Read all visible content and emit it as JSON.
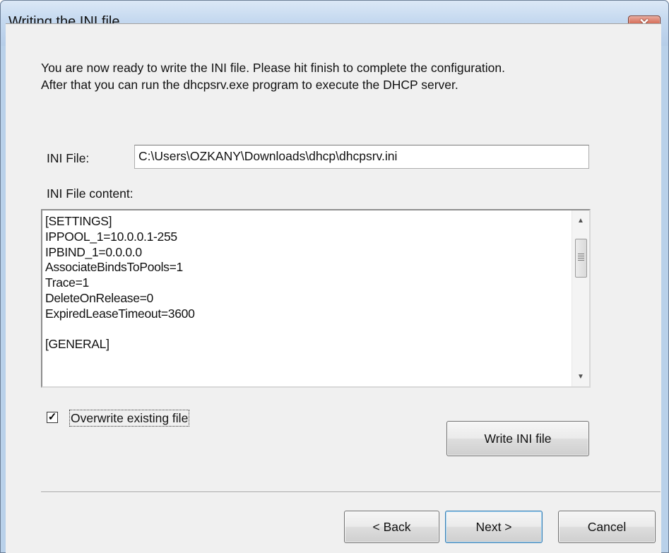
{
  "window": {
    "title": "Writing the INI file",
    "close_icon": "close-icon",
    "close_symbol": "✕"
  },
  "intro": {
    "line1": "You are now ready to write the INI file. Please hit finish to complete the configuration.",
    "line2": "After that you can run the dhcpsrv.exe program to execute the DHCP server."
  },
  "ini_file": {
    "label": "INI File:",
    "value": "C:\\Users\\OZKANY\\Downloads\\dhcp\\dhcpsrv.ini"
  },
  "ini_content": {
    "label": "INI File content:",
    "lines": [
      "[SETTINGS]",
      "IPPOOL_1=10.0.0.1-255",
      "IPBIND_1=0.0.0.0",
      "AssociateBindsToPools=1",
      "Trace=1",
      "DeleteOnRelease=0",
      "ExpiredLeaseTimeout=3600",
      "",
      "[GENERAL]"
    ]
  },
  "overwrite": {
    "label": "Overwrite existing file",
    "checked": true,
    "check_symbol": "✓"
  },
  "buttons": {
    "write": "Write INI file",
    "back": "< Back",
    "next": "Next >",
    "cancel": "Cancel"
  },
  "scrollbar": {
    "up_arrow": "▲",
    "down_arrow": "▼"
  },
  "colors": {
    "titlebar": "#c4d8ef",
    "close_button": "#c44a31",
    "dialog_background": "#f0f0f0"
  }
}
